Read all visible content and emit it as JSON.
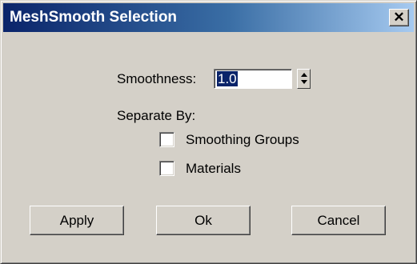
{
  "window": {
    "title": "MeshSmooth Selection",
    "close_glyph": "✕",
    "close_icon": "close-icon"
  },
  "form": {
    "smoothness_label": "Smoothness:",
    "smoothness_value": "1.0",
    "separate_by_label": "Separate By:",
    "checkboxes": [
      {
        "label": "Smoothing Groups",
        "checked": false
      },
      {
        "label": "Materials",
        "checked": false
      }
    ]
  },
  "buttons": {
    "apply": "Apply",
    "ok": "Ok",
    "cancel": "Cancel"
  },
  "colors": {
    "face": "#d4d0c8",
    "title_active_start": "#0a246a",
    "title_active_end": "#a6caf0",
    "selection": "#0a246a"
  }
}
